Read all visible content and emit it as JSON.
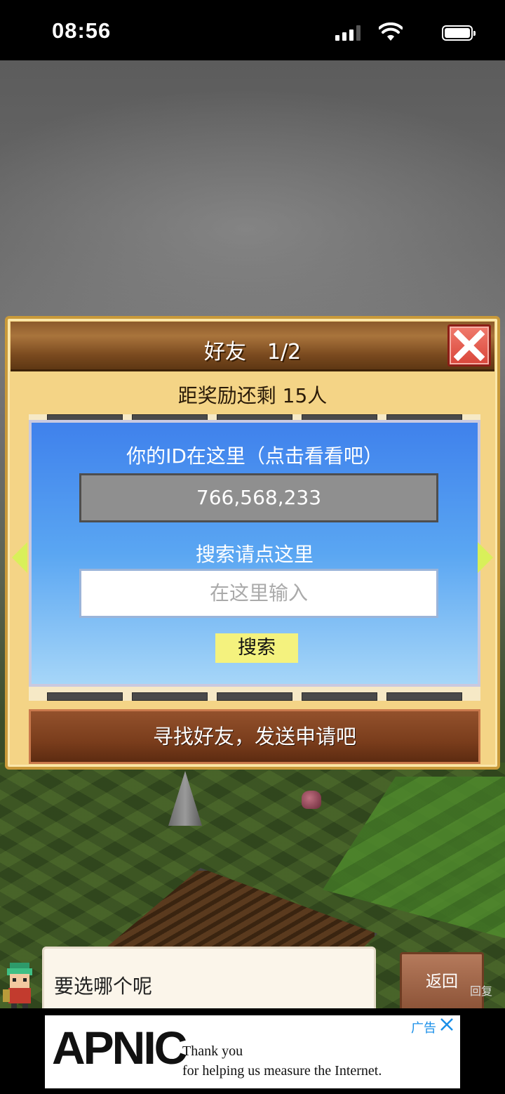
{
  "status_bar": {
    "time": "08:56"
  },
  "dialog": {
    "title": "好友　1/2",
    "reward_text": "距奖励还剩 15人",
    "id_label": "你的ID在这里（点击看看吧）",
    "id_value": "766,568,233",
    "search_label": "搜索请点这里",
    "search_placeholder": "在这里输入",
    "search_button": "搜索",
    "find_friends_button": "寻找好友，发送申请吧"
  },
  "speech": {
    "text": "要选哪个呢"
  },
  "return_button": "返回",
  "reply_hint": "回复",
  "ad": {
    "logo": "APNIC",
    "line1": "Thank you",
    "line2": "for helping us measure the Internet.",
    "badge": "广告"
  },
  "colors": {
    "panel_blue": "#3f81ec",
    "search_button": "#f4f27e",
    "close_red": "#d9463a",
    "header_brown": "#8b5a2b"
  }
}
